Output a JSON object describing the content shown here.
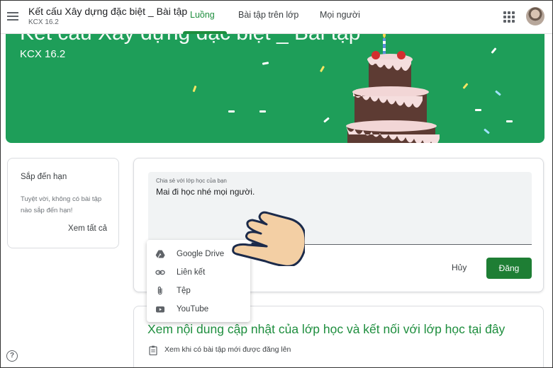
{
  "header": {
    "title": "Kết cấu Xây dựng đặc biệt _ Bài tập",
    "subtitle": "KCX 16.2",
    "tabs": [
      {
        "label": "Luồng",
        "active": true
      },
      {
        "label": "Bài tập trên lớp",
        "active": false
      },
      {
        "label": "Mọi người",
        "active": false
      }
    ]
  },
  "banner": {
    "title": "Kết cấu Xây dựng đặc biệt _ Bài tập",
    "subtitle": "KCX 16.2",
    "color": "#1e9e59"
  },
  "upcoming": {
    "title": "Sắp đến hạn",
    "text": "Tuyệt vời, không có bài tập nào sắp đến hạn!",
    "link": "Xem tất cả"
  },
  "compose": {
    "label": "Chia sẻ với lớp học của bạn",
    "value": "Mai đi học nhé mọi người.",
    "cancel": "Hủy",
    "post": "Đăng"
  },
  "attach_menu": {
    "items": [
      {
        "label": "Google Drive",
        "icon": "google-drive-icon"
      },
      {
        "label": "Liên kết",
        "icon": "link-icon"
      },
      {
        "label": "Tệp",
        "icon": "paperclip-icon"
      },
      {
        "label": "YouTube",
        "icon": "youtube-icon"
      }
    ]
  },
  "stream": {
    "title": "Xem nội dung cập nhật của lớp học và kết nối với lớp học tại đây",
    "hint": "Xem khi có bài tập mới được đăng lên"
  },
  "colors": {
    "accent": "#1e8e3e",
    "post_button": "#1e7e34"
  }
}
